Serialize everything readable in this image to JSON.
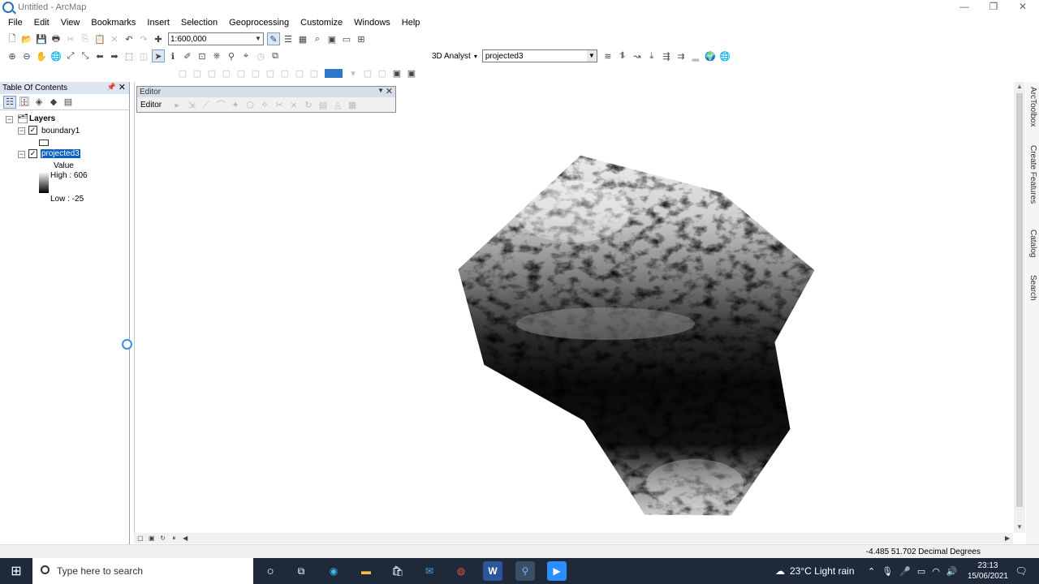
{
  "window": {
    "title": "Untitled - ArcMap",
    "minimize": "—",
    "restore": "❐",
    "close": "✕"
  },
  "menu": [
    "File",
    "Edit",
    "View",
    "Bookmarks",
    "Insert",
    "Selection",
    "Geoprocessing",
    "Customize",
    "Windows",
    "Help"
  ],
  "standard_toolbar": {
    "scale": "1:600,000"
  },
  "analyst_toolbar": {
    "label": "3D Analyst",
    "layer": "projected3"
  },
  "toc": {
    "title": "Table Of Contents",
    "root": "Layers",
    "layers": [
      {
        "name": "boundary1",
        "checked": true
      },
      {
        "name": "projected3",
        "checked": true,
        "selected": true
      }
    ],
    "legend": {
      "field": "Value",
      "high": "High : 606",
      "low": "Low : -25"
    }
  },
  "editor": {
    "title": "Editor",
    "menu_label": "Editor"
  },
  "status": {
    "coords": "-4.485  51.702 Decimal Degrees"
  },
  "dock": [
    "ArcToolbox",
    "Create Features",
    "Catalog",
    "Search"
  ],
  "taskbar": {
    "search_placeholder": "Type here to search",
    "weather": "23°C  Light rain",
    "time": "23:13",
    "date": "15/06/2021"
  }
}
